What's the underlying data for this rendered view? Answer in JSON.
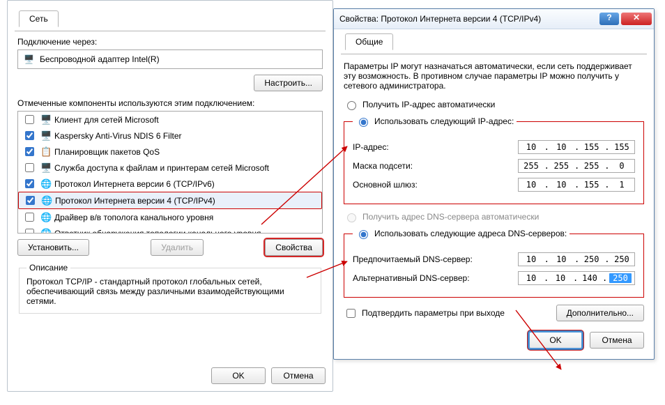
{
  "net": {
    "tab": "Сеть",
    "connection_label": "Подключение через:",
    "adapter": "Беспроводной адаптер Intel(R)",
    "configure_btn": "Настроить...",
    "component_note": "Отмеченные компоненты используются этим подключением:",
    "items": [
      {
        "checked": false,
        "icon": "🖥️",
        "label": "Клиент для сетей Microsoft"
      },
      {
        "checked": true,
        "icon": "🖥️",
        "label": "Kaspersky Anti-Virus NDIS 6 Filter"
      },
      {
        "checked": true,
        "icon": "📋",
        "label": "Планировщик пакетов QoS"
      },
      {
        "checked": false,
        "icon": "🖥️",
        "label": "Служба доступа к файлам и принтерам сетей Microsoft"
      },
      {
        "checked": true,
        "icon": "🌐",
        "label": "Протокол Интернета версии 6 (TCP/IPv6)"
      },
      {
        "checked": true,
        "icon": "🌐",
        "label": "Протокол Интернета версии 4 (TCP/IPv4)"
      },
      {
        "checked": false,
        "icon": "🌐",
        "label": "Драйвер в/в тополога канального уровня"
      },
      {
        "checked": false,
        "icon": "🌐",
        "label": "Ответчик обнаружения топологии канального уровня"
      }
    ],
    "install_btn": "Установить...",
    "remove_btn": "Удалить",
    "props_btn": "Свойства",
    "desc_legend": "Описание",
    "description": "Протокол TCP/IP - стандартный протокол глобальных сетей, обеспечивающий связь между различными взаимодействующими сетями.",
    "ok_btn": "OK",
    "cancel_btn": "Отмена"
  },
  "ipv4": {
    "win_title": "Свойства: Протокол Интернета версии 4 (TCP/IPv4)",
    "tab": "Общие",
    "intro": "Параметры IP могут назначаться автоматически, если сеть поддерживает эту возможность. В противном случае параметры IP можно получить у сетевого администратора.",
    "radio_auto_ip": "Получить IP-адрес автоматически",
    "radio_manual_ip": "Использовать следующий IP-адрес:",
    "lbl_ip": "IP-адрес:",
    "ip": [
      "10",
      "10",
      "155",
      "155"
    ],
    "lbl_mask": "Маска подсети:",
    "mask": [
      "255",
      "255",
      "255",
      "0"
    ],
    "lbl_gw": "Основной шлюз:",
    "gw": [
      "10",
      "10",
      "155",
      "1"
    ],
    "radio_auto_dns": "Получить адрес DNS-сервера автоматически",
    "radio_manual_dns": "Использовать следующие адреса DNS-серверов:",
    "lbl_dns1": "Предпочитаемый DNS-сервер:",
    "dns1": [
      "10",
      "10",
      "250",
      "250"
    ],
    "lbl_dns2": "Альтернативный DNS-сервер:",
    "dns2": [
      "10",
      "10",
      "140",
      "250"
    ],
    "confirm_chk": "Подтвердить параметры при выходе",
    "advanced_btn": "Дополнительно...",
    "ok_btn": "OK",
    "cancel_btn": "Отмена"
  }
}
